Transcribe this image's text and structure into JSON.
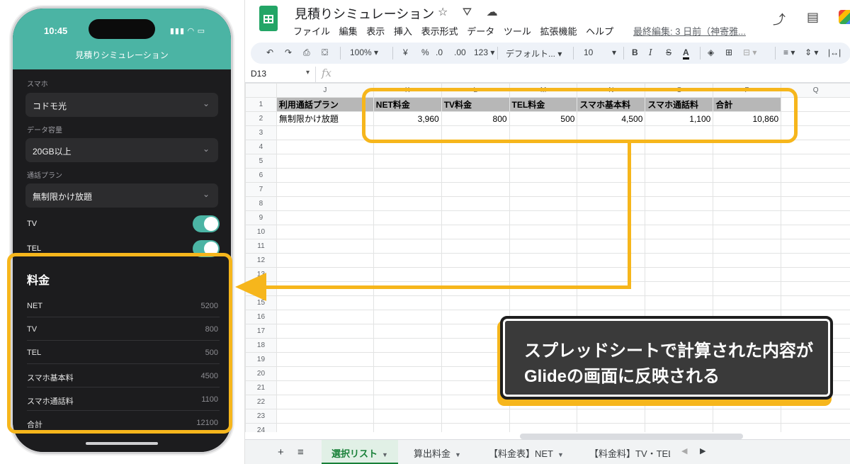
{
  "phone": {
    "status_time": "10:45",
    "status_icons": "▮▮▮ ◠ ▭",
    "app_title": "見積りシミュレーション",
    "fields": [
      {
        "label": "スマホ",
        "value": "コドモ光"
      },
      {
        "label": "データ容量",
        "value": "20GB以上"
      },
      {
        "label": "通話プラン",
        "value": "無制限かけ放題"
      }
    ],
    "toggles": [
      {
        "label": "TV",
        "on": true
      },
      {
        "label": "TEL",
        "on": true
      }
    ],
    "fee_title": "料金",
    "fees": [
      {
        "name": "NET",
        "value": "5200"
      },
      {
        "name": "TV",
        "value": "800"
      },
      {
        "name": "TEL",
        "value": "500"
      },
      {
        "name": "スマホ基本料",
        "value": "4500"
      },
      {
        "name": "スマホ通話料",
        "value": "1100"
      },
      {
        "name": "合計",
        "value": "12100"
      }
    ]
  },
  "sheets": {
    "doc_title": "見積りシミュレーション",
    "title_icons": "☆ ⛛ ☁",
    "menu": [
      "ファイル",
      "編集",
      "表示",
      "挿入",
      "表示形式",
      "データ",
      "ツール",
      "拡張機能",
      "ヘルプ"
    ],
    "last_edit": "最終編集: 3 日前（神寄雅...",
    "toolbar": {
      "undo": "↶",
      "redo": "↷",
      "print": "⎙",
      "paint": "⛋",
      "zoom": "100%",
      "currency": "¥",
      "percent": "%",
      "dec_less": ".0",
      "dec_more": ".00",
      "numfmt": "123",
      "font": "デフォルト...",
      "font_size": "10",
      "bold": "B",
      "italic": "I",
      "strike": "S",
      "text_color": "A"
    },
    "name_box": "D13",
    "fx": "fx",
    "column_headers": [
      "J",
      "K",
      "L",
      "M",
      "N",
      "O",
      "P",
      "Q"
    ],
    "row_numbers": [
      "1",
      "2",
      "3",
      "4",
      "5",
      "6",
      "7",
      "8",
      "9",
      "10",
      "11",
      "12",
      "13",
      "14",
      "15",
      "16",
      "17",
      "18",
      "19",
      "20",
      "21",
      "22",
      "23",
      "24"
    ],
    "header_row": [
      "利用通話プラン",
      "NET料金",
      "TV料金",
      "TEL料金",
      "スマホ基本料",
      "スマホ通話料",
      "合計",
      ""
    ],
    "data_row": [
      "無制限かけ放題",
      "3,960",
      "800",
      "500",
      "4,500",
      "1,100",
      "10,860",
      ""
    ],
    "callout_line1": "スプレッドシートで計算された内容が",
    "callout_line2": "Glideの画面に反映される",
    "tabs": [
      {
        "label": "選択リスト",
        "active": true
      },
      {
        "label": "算出料金",
        "active": false
      },
      {
        "label": "【料金表】NET",
        "active": false
      },
      {
        "label": "【料金料】TV・TEL",
        "active": false
      }
    ]
  },
  "colors": {
    "accent_teal": "#4bb4a4",
    "highlight_yellow": "#f6b61c",
    "sheets_green": "#188038"
  }
}
